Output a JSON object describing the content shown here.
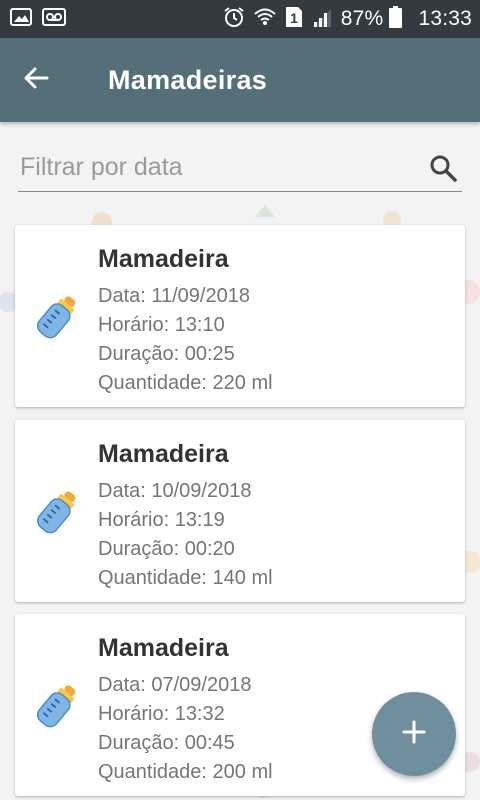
{
  "status_bar": {
    "battery": "87%",
    "time": "13:33",
    "sim_label": "1"
  },
  "app_bar": {
    "title": "Mamadeiras"
  },
  "search": {
    "placeholder": "Filtrar por data"
  },
  "entries": [
    {
      "title": "Mamadeira",
      "date": "Data: 11/09/2018",
      "time": "Horário: 13:10",
      "duration": "Duração: 00:25",
      "quantity": "Quantidade: 220 ml"
    },
    {
      "title": "Mamadeira",
      "date": "Data: 10/09/2018",
      "time": "Horário: 13:19",
      "duration": "Duração: 00:20",
      "quantity": "Quantidade: 140 ml"
    },
    {
      "title": "Mamadeira",
      "date": "Data: 07/09/2018",
      "time": "Horário: 13:32",
      "duration": "Duração: 00:45",
      "quantity": "Quantidade: 200 ml"
    }
  ],
  "colors": {
    "status_bar": "#333b40",
    "app_bar": "#546e7a",
    "fab": "#6f8f9e",
    "bottle": "#7fb6e6"
  },
  "icons": {
    "back": "arrow-back-icon",
    "search": "search-icon",
    "entry": "baby-bottle-icon",
    "fab": "plus-icon"
  }
}
